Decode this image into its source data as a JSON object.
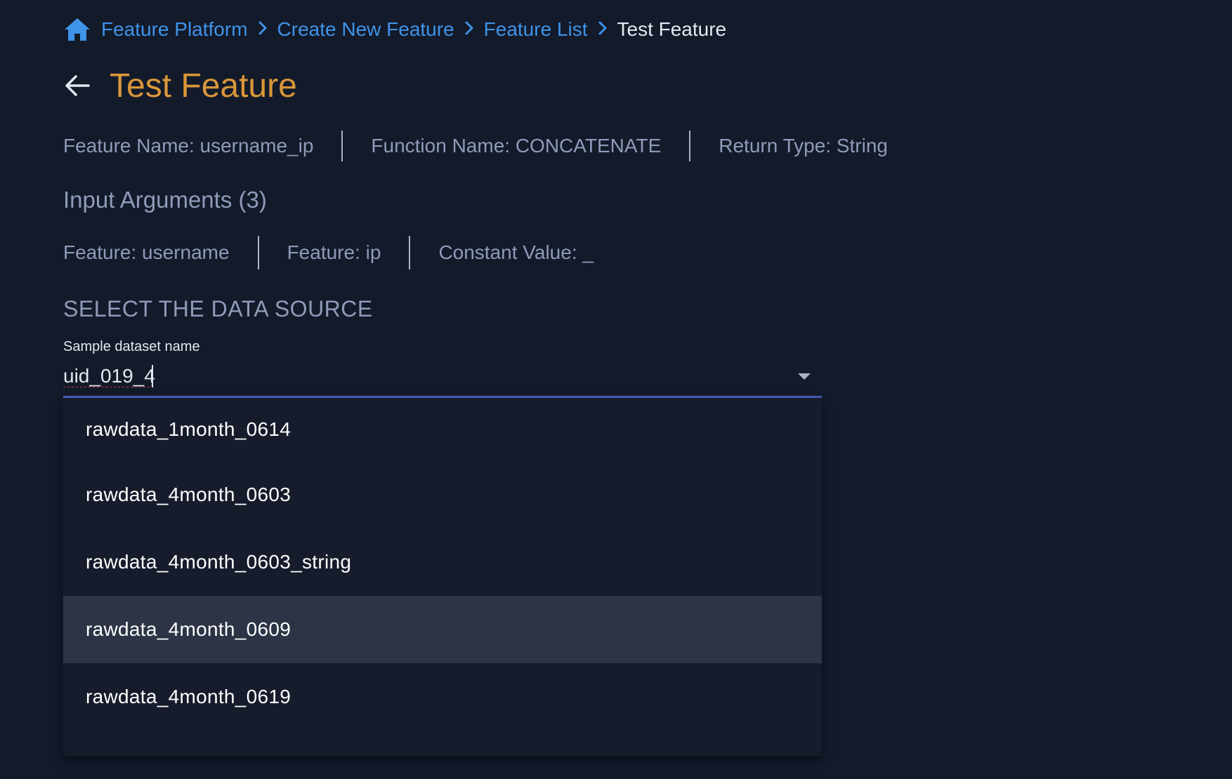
{
  "breadcrumb": {
    "items": [
      "Feature Platform",
      "Create New Feature",
      "Feature List"
    ],
    "current": "Test Feature",
    "separator": ">"
  },
  "title": "Test Feature",
  "meta": {
    "feature_name": "Feature Name: username_ip",
    "function_name": "Function Name: CONCATENATE",
    "return_type": "Return Type: String"
  },
  "input_arguments": {
    "heading": "Input Arguments (3)",
    "items": [
      "Feature: username",
      "Feature: ip",
      "Constant Value: _"
    ]
  },
  "data_source": {
    "heading": "SELECT THE DATA SOURCE",
    "label": "Sample dataset name",
    "value": "uid_019_4",
    "options": [
      "rawdata_1month_0614",
      "rawdata_4month_0603",
      "rawdata_4month_0603_string",
      "rawdata_4month_0609",
      "rawdata_4month_0619"
    ],
    "highlighted_option": "rawdata_4month_0609"
  },
  "icons": {
    "home": "home-icon",
    "back": "arrow-left-icon",
    "breadcrumb_separator": "chevron-right-icon",
    "dropdown": "caret-down-icon"
  },
  "colors": {
    "background": "#131a2a",
    "link": "#3f93e8",
    "title": "#d9963a",
    "muted_text": "#8f9bb8",
    "underline_active": "#4a61c4",
    "dropdown_bg": "#161c2b",
    "option_highlight": "#2c3446"
  }
}
